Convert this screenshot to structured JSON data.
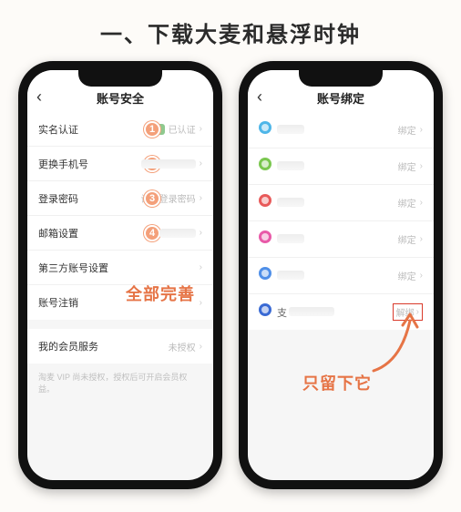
{
  "title": "一、下载大麦和悬浮时钟",
  "left": {
    "header": "账号安全",
    "rows": [
      {
        "label": "实名认证",
        "badge": "1",
        "right": "已认证",
        "verified": true
      },
      {
        "label": "更换手机号",
        "badge": "2",
        "right": ""
      },
      {
        "label": "登录密码",
        "badge": "3",
        "right": "设置登录密码"
      },
      {
        "label": "邮箱设置",
        "badge": "4",
        "right": ""
      },
      {
        "label": "第三方账号设置",
        "right": ""
      },
      {
        "label": "账号注销",
        "right": ""
      }
    ],
    "member_row": {
      "label": "我的会员服务",
      "right": "未授权"
    },
    "note": "淘麦 VIP 尚未授权，授权后可开启会员权益。",
    "annotation": "全部完善"
  },
  "right": {
    "header": "账号绑定",
    "rows": [
      {
        "color": "#4fb6e8",
        "label": "",
        "status": "绑定"
      },
      {
        "color": "#7ac74f",
        "label": "",
        "status": "绑定"
      },
      {
        "color": "#e85a5a",
        "label": "",
        "status": "绑定"
      },
      {
        "color": "#e85aa8",
        "label": "",
        "status": "绑定"
      },
      {
        "color": "#4f8fe8",
        "label": "",
        "status": "绑定"
      },
      {
        "color": "#3a6ad4",
        "label": "支",
        "status": "解绑",
        "highlight": true
      }
    ],
    "annotation": "只留下它"
  }
}
